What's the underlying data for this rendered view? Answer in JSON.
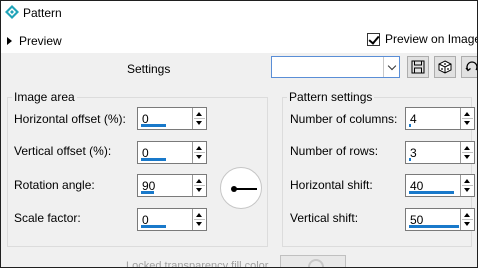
{
  "window": {
    "title": "Pattern"
  },
  "preview": {
    "label": "Preview",
    "on_image_label": "Preview on Image",
    "on_image_checked": true
  },
  "settings": {
    "label": "Settings",
    "preset_value": ""
  },
  "toolbar": {
    "icons": [
      "save-icon",
      "random-icon",
      "reset-icon"
    ]
  },
  "image_area": {
    "title": "Image area",
    "horizontal_offset": {
      "label": "Horizontal offset (%):",
      "value": "0",
      "level": 0.5
    },
    "vertical_offset": {
      "label": "Vertical offset (%):",
      "value": "0",
      "level": 0.5
    },
    "rotation_angle": {
      "label": "Rotation angle:",
      "value": "90",
      "level": 0.25
    },
    "scale_factor": {
      "label": "Scale factor:",
      "value": "0",
      "level": 0.5
    }
  },
  "pattern_settings": {
    "title": "Pattern settings",
    "columns": {
      "label": "Number of columns:",
      "value": "4",
      "level": 0.04
    },
    "rows": {
      "label": "Number of rows:",
      "value": "3",
      "level": 0.0
    },
    "horizontal_shift": {
      "label": "Horizontal shift:",
      "value": "40",
      "level": 0.9
    },
    "vertical_shift": {
      "label": "Vertical shift:",
      "value": "50",
      "level": 1.0
    }
  },
  "footer": {
    "cut_label": "Locked transparency fill color"
  },
  "colors": {
    "accent": "#1979ca",
    "icon_teal": "#1fa3b8"
  }
}
